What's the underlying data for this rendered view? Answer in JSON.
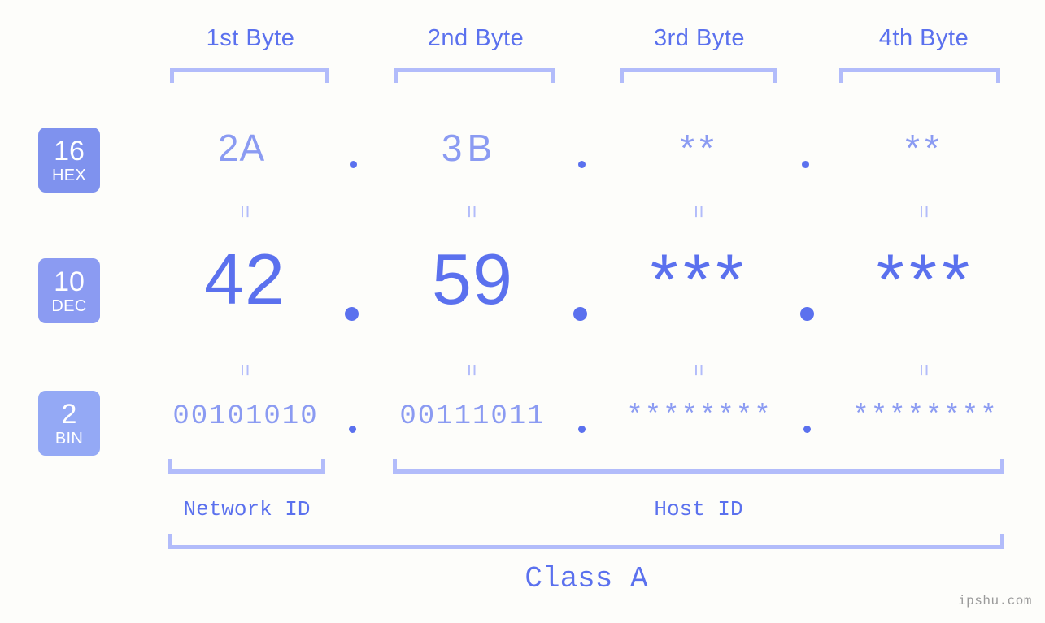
{
  "meta": {
    "watermark": "ipshu.com",
    "background_color": "#fdfdfa",
    "accent_strong": "#5b71ee",
    "accent_mid": "#8b9bf2",
    "accent_light": "#b2bcfa"
  },
  "columns": [
    {
      "header": "1st Byte"
    },
    {
      "header": "2nd Byte"
    },
    {
      "header": "3rd Byte"
    },
    {
      "header": "4th Byte"
    }
  ],
  "rows": [
    {
      "badge_number": "16",
      "badge_name": "HEX",
      "badge_color": "#7f92ee",
      "values": [
        "2A",
        "3B",
        "**",
        "**"
      ]
    },
    {
      "badge_number": "10",
      "badge_name": "DEC",
      "badge_color": "#8b9bf2",
      "values": [
        "42",
        "59",
        "***",
        "***"
      ]
    },
    {
      "badge_number": "2",
      "badge_name": "BIN",
      "badge_color": "#94a9f5",
      "values": [
        "00101010",
        "00111011",
        "********",
        "********"
      ]
    }
  ],
  "separators": {
    "dot": ".",
    "equals": "="
  },
  "sections": {
    "network_id": "Network ID",
    "host_id": "Host ID",
    "class": "Class A"
  }
}
